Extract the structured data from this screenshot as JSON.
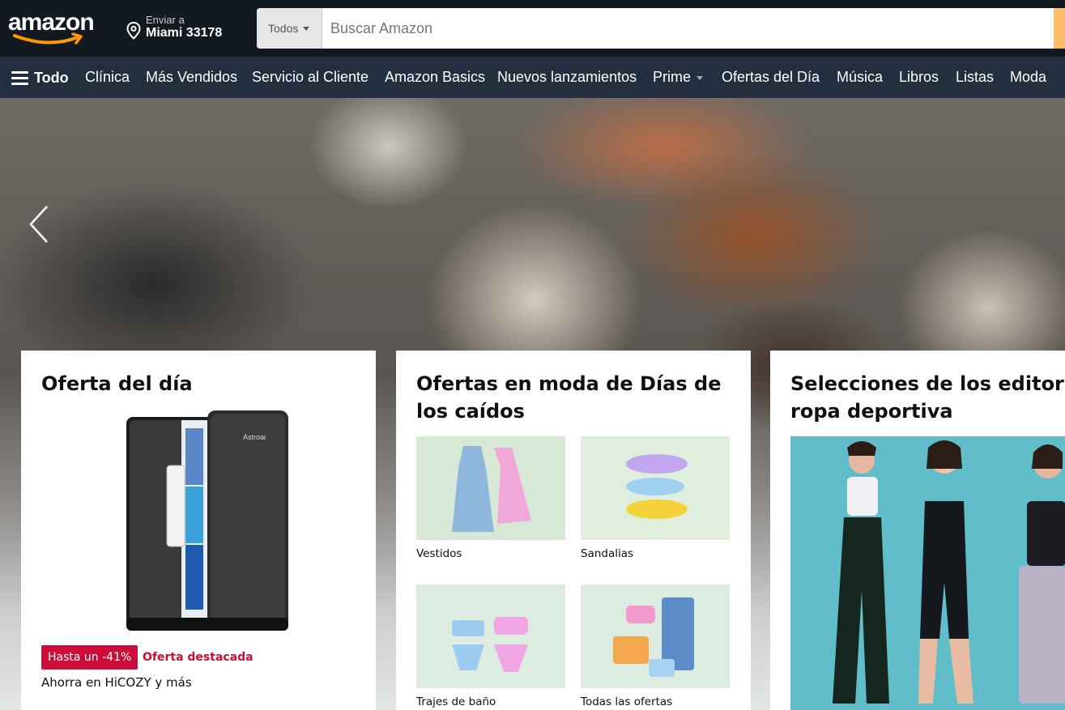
{
  "header": {
    "logo_text": "amazon",
    "deliver_line1": "Enviar a",
    "deliver_line2": "Miami 33178",
    "search_category": "Todos",
    "search_placeholder": "Buscar Amazon"
  },
  "nav": {
    "all_label": "Todo",
    "items": [
      "Clínica",
      "Más Vendidos",
      "Servicio al Cliente",
      "Amazon Basics",
      "Nuevos lanzamientos",
      "Prime",
      "Ofertas del Día",
      "Música",
      "Libros",
      "Listas",
      "Moda"
    ]
  },
  "cards": {
    "deal": {
      "title": "Oferta del día",
      "badge": "Hasta un -41%",
      "badge_label": "Oferta destacada",
      "subtitle": "Ahorra en HiCOZY y más",
      "brand_on_product": "Astroai"
    },
    "fashion": {
      "title": "Ofertas en moda de Días de los caídos",
      "items": [
        "Vestidos",
        "Sandalias",
        "Trajes de baño",
        "Todas las ofertas"
      ]
    },
    "editors": {
      "title": "Selecciones de los editores: ropa deportiva"
    }
  },
  "colors": {
    "header_bg": "#131921",
    "nav_bg": "#232f3e",
    "search_button": "#febd69",
    "deal_red": "#cc0c39",
    "page_bg": "#e3e6e6"
  }
}
